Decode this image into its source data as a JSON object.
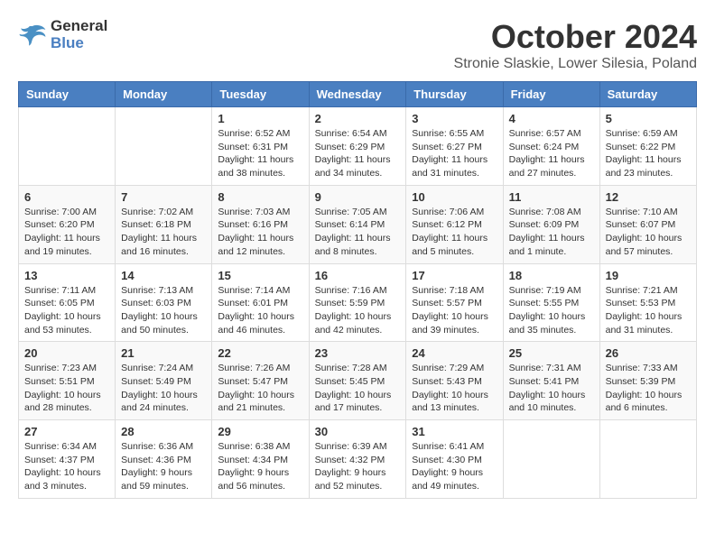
{
  "logo": {
    "line1": "General",
    "line2": "Blue"
  },
  "title": "October 2024",
  "location": "Stronie Slaskie, Lower Silesia, Poland",
  "weekdays": [
    "Sunday",
    "Monday",
    "Tuesday",
    "Wednesday",
    "Thursday",
    "Friday",
    "Saturday"
  ],
  "weeks": [
    [
      {
        "day": "",
        "info": ""
      },
      {
        "day": "",
        "info": ""
      },
      {
        "day": "1",
        "info": "Sunrise: 6:52 AM\nSunset: 6:31 PM\nDaylight: 11 hours and 38 minutes."
      },
      {
        "day": "2",
        "info": "Sunrise: 6:54 AM\nSunset: 6:29 PM\nDaylight: 11 hours and 34 minutes."
      },
      {
        "day": "3",
        "info": "Sunrise: 6:55 AM\nSunset: 6:27 PM\nDaylight: 11 hours and 31 minutes."
      },
      {
        "day": "4",
        "info": "Sunrise: 6:57 AM\nSunset: 6:24 PM\nDaylight: 11 hours and 27 minutes."
      },
      {
        "day": "5",
        "info": "Sunrise: 6:59 AM\nSunset: 6:22 PM\nDaylight: 11 hours and 23 minutes."
      }
    ],
    [
      {
        "day": "6",
        "info": "Sunrise: 7:00 AM\nSunset: 6:20 PM\nDaylight: 11 hours and 19 minutes."
      },
      {
        "day": "7",
        "info": "Sunrise: 7:02 AM\nSunset: 6:18 PM\nDaylight: 11 hours and 16 minutes."
      },
      {
        "day": "8",
        "info": "Sunrise: 7:03 AM\nSunset: 6:16 PM\nDaylight: 11 hours and 12 minutes."
      },
      {
        "day": "9",
        "info": "Sunrise: 7:05 AM\nSunset: 6:14 PM\nDaylight: 11 hours and 8 minutes."
      },
      {
        "day": "10",
        "info": "Sunrise: 7:06 AM\nSunset: 6:12 PM\nDaylight: 11 hours and 5 minutes."
      },
      {
        "day": "11",
        "info": "Sunrise: 7:08 AM\nSunset: 6:09 PM\nDaylight: 11 hours and 1 minute."
      },
      {
        "day": "12",
        "info": "Sunrise: 7:10 AM\nSunset: 6:07 PM\nDaylight: 10 hours and 57 minutes."
      }
    ],
    [
      {
        "day": "13",
        "info": "Sunrise: 7:11 AM\nSunset: 6:05 PM\nDaylight: 10 hours and 53 minutes."
      },
      {
        "day": "14",
        "info": "Sunrise: 7:13 AM\nSunset: 6:03 PM\nDaylight: 10 hours and 50 minutes."
      },
      {
        "day": "15",
        "info": "Sunrise: 7:14 AM\nSunset: 6:01 PM\nDaylight: 10 hours and 46 minutes."
      },
      {
        "day": "16",
        "info": "Sunrise: 7:16 AM\nSunset: 5:59 PM\nDaylight: 10 hours and 42 minutes."
      },
      {
        "day": "17",
        "info": "Sunrise: 7:18 AM\nSunset: 5:57 PM\nDaylight: 10 hours and 39 minutes."
      },
      {
        "day": "18",
        "info": "Sunrise: 7:19 AM\nSunset: 5:55 PM\nDaylight: 10 hours and 35 minutes."
      },
      {
        "day": "19",
        "info": "Sunrise: 7:21 AM\nSunset: 5:53 PM\nDaylight: 10 hours and 31 minutes."
      }
    ],
    [
      {
        "day": "20",
        "info": "Sunrise: 7:23 AM\nSunset: 5:51 PM\nDaylight: 10 hours and 28 minutes."
      },
      {
        "day": "21",
        "info": "Sunrise: 7:24 AM\nSunset: 5:49 PM\nDaylight: 10 hours and 24 minutes."
      },
      {
        "day": "22",
        "info": "Sunrise: 7:26 AM\nSunset: 5:47 PM\nDaylight: 10 hours and 21 minutes."
      },
      {
        "day": "23",
        "info": "Sunrise: 7:28 AM\nSunset: 5:45 PM\nDaylight: 10 hours and 17 minutes."
      },
      {
        "day": "24",
        "info": "Sunrise: 7:29 AM\nSunset: 5:43 PM\nDaylight: 10 hours and 13 minutes."
      },
      {
        "day": "25",
        "info": "Sunrise: 7:31 AM\nSunset: 5:41 PM\nDaylight: 10 hours and 10 minutes."
      },
      {
        "day": "26",
        "info": "Sunrise: 7:33 AM\nSunset: 5:39 PM\nDaylight: 10 hours and 6 minutes."
      }
    ],
    [
      {
        "day": "27",
        "info": "Sunrise: 6:34 AM\nSunset: 4:37 PM\nDaylight: 10 hours and 3 minutes."
      },
      {
        "day": "28",
        "info": "Sunrise: 6:36 AM\nSunset: 4:36 PM\nDaylight: 9 hours and 59 minutes."
      },
      {
        "day": "29",
        "info": "Sunrise: 6:38 AM\nSunset: 4:34 PM\nDaylight: 9 hours and 56 minutes."
      },
      {
        "day": "30",
        "info": "Sunrise: 6:39 AM\nSunset: 4:32 PM\nDaylight: 9 hours and 52 minutes."
      },
      {
        "day": "31",
        "info": "Sunrise: 6:41 AM\nSunset: 4:30 PM\nDaylight: 9 hours and 49 minutes."
      },
      {
        "day": "",
        "info": ""
      },
      {
        "day": "",
        "info": ""
      }
    ]
  ]
}
